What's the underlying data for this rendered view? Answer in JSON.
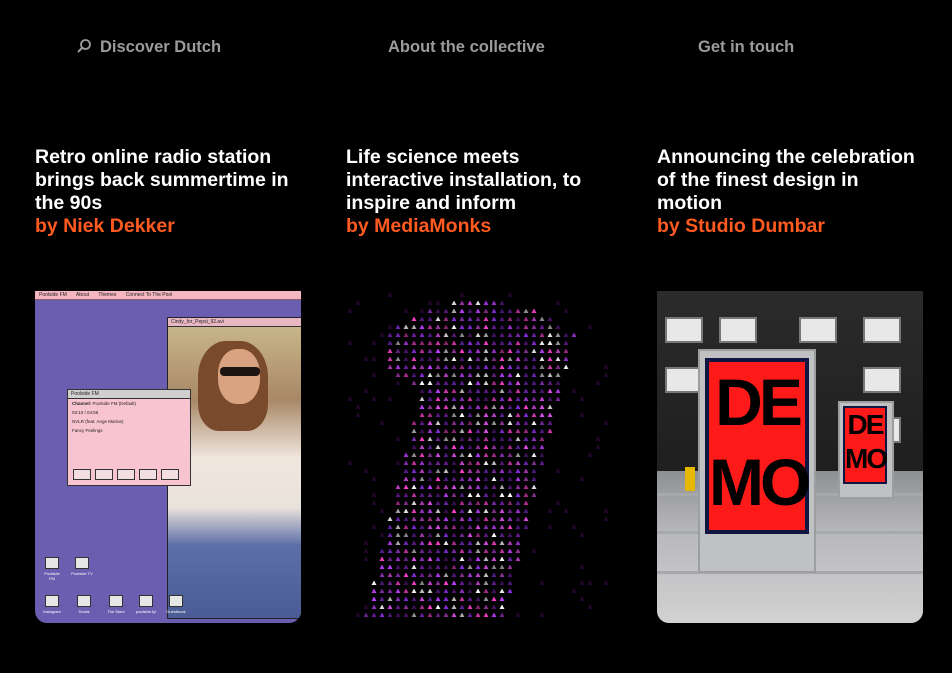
{
  "nav": {
    "discover": "Discover Dutch",
    "about": "About the collective",
    "contact": "Get in touch"
  },
  "cards": [
    {
      "title": "Retro online radio station brings back summertime in the 90s",
      "byline": "by Niek Dekker",
      "image": {
        "menu": [
          "Poolside FM",
          "About",
          "Themes",
          "Connect To The Pool"
        ],
        "photo_window_title": "Cindy_for_Pepsi_92.avi",
        "player_title": "Poolside FM",
        "channel_label": "Channel:",
        "channel_value": "Poolside FM (Default)",
        "time": "03:10 / 04:56",
        "track": "NVLR (feat. Ange Marine)",
        "artist": "Fancy Feelings",
        "desktop_icons": [
          "Poolside FM",
          "Poolside TV",
          "Instagram",
          "Social",
          "The Store",
          "poolside.fyi",
          "Guestbook"
        ]
      }
    },
    {
      "title": "Life science meets interactive installation, to inspire and inform",
      "byline": "by MediaMonks",
      "image": {}
    },
    {
      "title": "Announcing the celebration of the finest design in motion",
      "byline": "by Studio Dumbar",
      "image": {
        "poster_top": "DE",
        "poster_mid": "MO"
      }
    }
  ],
  "colors": {
    "background": "#000000",
    "nav_text": "#9b9b9b",
    "title_text": "#ffffff",
    "byline": "#ff5a1f",
    "retro_purple": "#6b5eb0",
    "poster_red": "#ff1a1a"
  },
  "icons": {
    "search": "search-icon"
  }
}
